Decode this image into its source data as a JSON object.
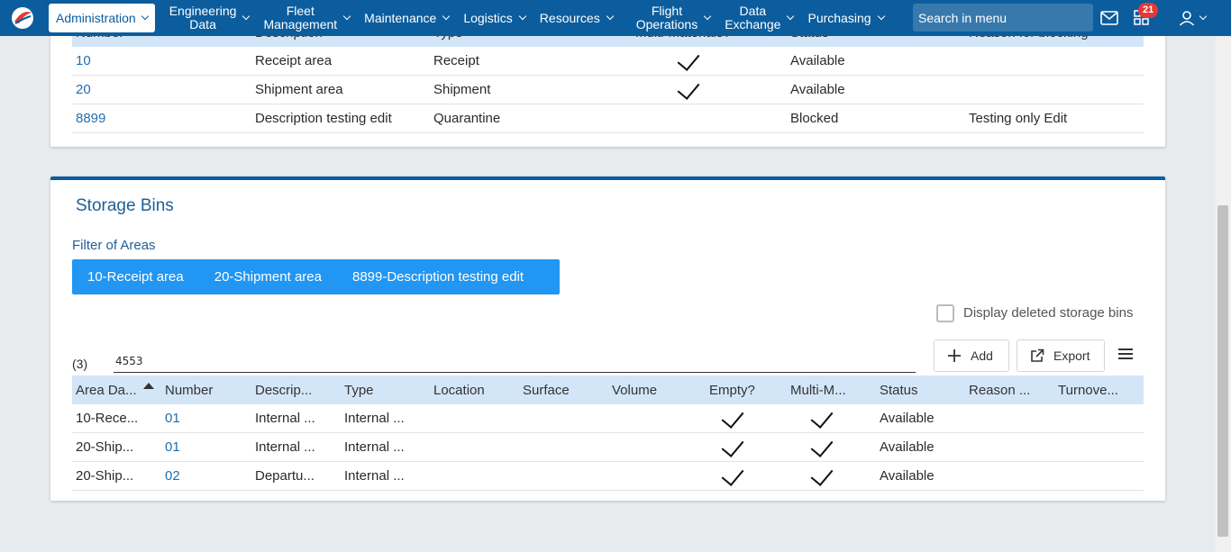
{
  "nav": {
    "active_label": "Administration",
    "items": [
      {
        "line1": "Engineering",
        "line2": "Data"
      },
      {
        "line1": "Fleet",
        "line2": "Management"
      },
      {
        "line1": "Maintenance",
        "line2": ""
      },
      {
        "line1": "Logistics",
        "line2": ""
      },
      {
        "line1": "Resources",
        "line2": ""
      },
      {
        "line1": "Flight",
        "line2": "Operations"
      },
      {
        "line1": "Data",
        "line2": "Exchange"
      },
      {
        "line1": "Purchasing",
        "line2": ""
      }
    ],
    "search_placeholder": "Search in menu",
    "badge_count": "21"
  },
  "areas_table": {
    "headers": [
      "Number",
      "Description",
      "Type",
      "Multi-Materials?",
      "Status",
      "Reason for blocking"
    ],
    "rows": [
      {
        "number": "10",
        "description": "Receipt area",
        "type": "Receipt",
        "multi": true,
        "status": "Available",
        "reason": ""
      },
      {
        "number": "20",
        "description": "Shipment area",
        "type": "Shipment",
        "multi": true,
        "status": "Available",
        "reason": ""
      },
      {
        "number": "8899",
        "description": "Description testing edit",
        "type": "Quarantine",
        "multi": false,
        "status": "Blocked",
        "reason": "Testing only Edit"
      }
    ]
  },
  "storage_bins": {
    "title": "Storage Bins",
    "filter_label": "Filter of Areas",
    "filters": [
      "10-Receipt area",
      "20-Shipment area",
      "8899-Description testing edit"
    ],
    "display_deleted_label": "Display deleted storage bins",
    "count": "(3)",
    "search_value": "4553",
    "add_label": "Add",
    "export_label": "Export",
    "headers": [
      "Area Da...",
      "Number",
      "Descrip...",
      "Type",
      "Location",
      "Surface",
      "Volume",
      "Empty?",
      "Multi-M...",
      "Status",
      "Reason ...",
      "Turnove..."
    ],
    "rows": [
      {
        "area": "10-Rece...",
        "number": "01",
        "description": "Internal ...",
        "type": "Internal ...",
        "empty": true,
        "multi": true,
        "status": "Available"
      },
      {
        "area": "20-Ship...",
        "number": "01",
        "description": "Internal ...",
        "type": "Internal ...",
        "empty": true,
        "multi": true,
        "status": "Available"
      },
      {
        "area": "20-Ship...",
        "number": "02",
        "description": "Departu...",
        "type": "Internal ...",
        "empty": true,
        "multi": true,
        "status": "Available"
      }
    ]
  }
}
